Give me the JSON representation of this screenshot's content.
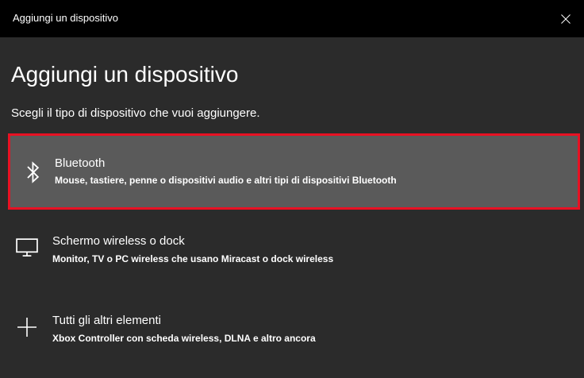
{
  "window": {
    "title": "Aggiungi un dispositivo",
    "close_icon": "close-icon"
  },
  "content": {
    "heading": "Aggiungi un dispositivo",
    "subtitle": "Scegli il tipo di dispositivo che vuoi aggiungere."
  },
  "options": [
    {
      "title": "Bluetooth",
      "description": "Mouse, tastiere, penne o dispositivi audio e altri tipi di dispositivi Bluetooth",
      "icon": "bluetooth-icon",
      "selected": true
    },
    {
      "title": "Schermo wireless o dock",
      "description": "Monitor, TV o PC wireless che usano Miracast o dock wireless",
      "icon": "monitor-icon",
      "selected": false
    },
    {
      "title": "Tutti gli altri elementi",
      "description": "Xbox Controller con scheda wireless, DLNA e altro ancora",
      "icon": "plus-icon",
      "selected": false
    }
  ],
  "colors": {
    "titlebar": "#000000",
    "background": "#2b2b2b",
    "selected_background": "#5a5a5a",
    "selection_border": "#e81123",
    "text": "#ffffff"
  }
}
